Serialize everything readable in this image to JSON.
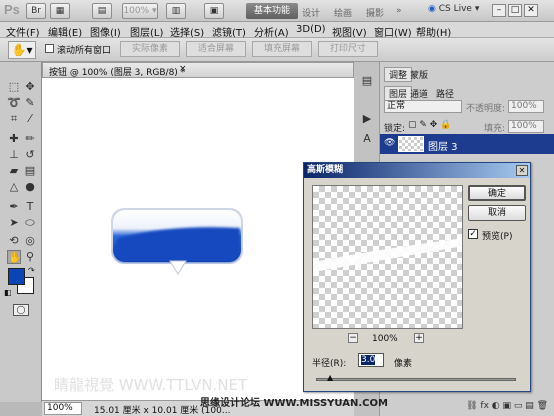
{
  "app": {
    "logo": "Ps",
    "zoom_select": "100%",
    "workspaces": {
      "active": "基本功能",
      "others": [
        "设计",
        "绘画",
        "摄影"
      ]
    },
    "cs_live": "CS Live"
  },
  "menus": [
    "文件(F)",
    "编辑(E)",
    "图像(I)",
    "图层(L)",
    "选择(S)",
    "滤镜(T)",
    "分析(A)",
    "3D(D)",
    "视图(V)",
    "窗口(W)",
    "帮助(H)"
  ],
  "options": {
    "scroll_all_label": "滚动所有窗口",
    "buttons": [
      "实际像素",
      "适合屏幕",
      "填充屏幕",
      "打印尺寸"
    ]
  },
  "document": {
    "tab_title": "按钮 @ 100% (图层 3, RGB/8) *",
    "zoom": "100%",
    "size_info": "15.01 厘米 x 10.01 厘米 (100...",
    "watermark": "睛龍視覺 WWW.TTLVN.NET"
  },
  "colors": {
    "foreground": "#0a44b5",
    "background": "#ffffff",
    "accent": "#1d3c8f"
  },
  "panels": {
    "top_tabs": [
      "调整",
      "蒙版"
    ],
    "layer_tabs": [
      "图层",
      "通道",
      "路径"
    ],
    "blend_mode": "正常",
    "opacity_label": "不透明度:",
    "opacity_value": "100%",
    "lock_label": "锁定:",
    "fill_label": "填充:",
    "fill_value": "100%",
    "layer_name": "图层 3"
  },
  "dialog": {
    "title": "高斯模糊",
    "ok": "确定",
    "cancel": "取消",
    "preview_label": "预览(P)",
    "preview_checked": true,
    "zoom_minus": "−",
    "zoom_value": "100%",
    "zoom_plus": "+",
    "radius_label": "半径(R):",
    "radius_value": "3.0",
    "unit": "像素",
    "slider_fraction": 0.05
  },
  "footer_watermark": "思缘设计论坛 WWW.MISSYUAN.COM"
}
